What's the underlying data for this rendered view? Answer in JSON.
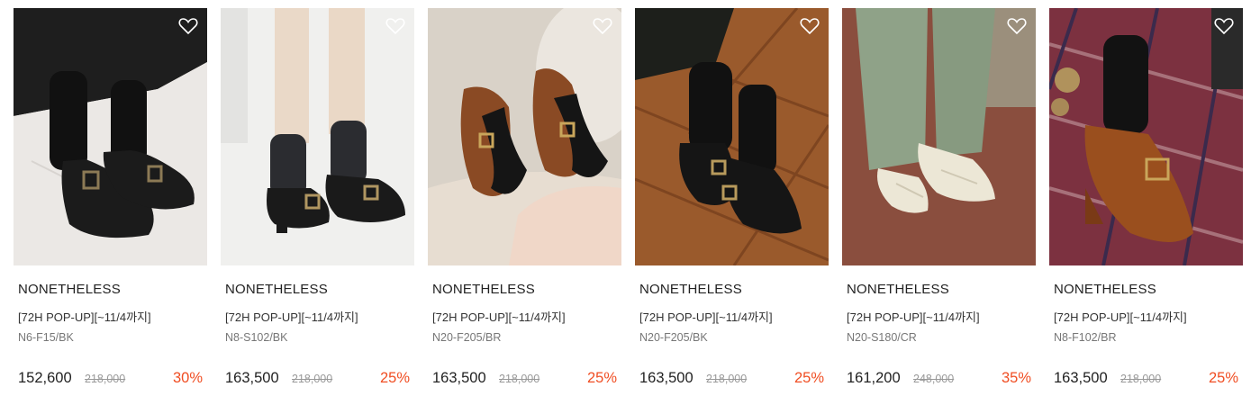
{
  "products": [
    {
      "brand": "NONETHELESS",
      "title": "[72H POP-UP][~11/4까지]",
      "code": "N6-F15/BK",
      "price": "152,600",
      "original_price": "218,000",
      "discount": "30%",
      "shoe_color": "#1b1b1b",
      "bg_color": "#e9e6e3"
    },
    {
      "brand": "NONETHELESS",
      "title": "[72H POP-UP][~11/4까지]",
      "code": "N8-S102/BK",
      "price": "163,500",
      "original_price": "218,000",
      "discount": "25%",
      "shoe_color": "#1a1a1a",
      "bg_color": "#eeeeec"
    },
    {
      "brand": "NONETHELESS",
      "title": "[72H POP-UP][~11/4까지]",
      "code": "N20-F205/BR",
      "price": "163,500",
      "original_price": "218,000",
      "discount": "25%",
      "shoe_color": "#8a4a24",
      "bg_color": "#ddd6cd"
    },
    {
      "brand": "NONETHELESS",
      "title": "[72H POP-UP][~11/4까지]",
      "code": "N20-F205/BK",
      "price": "163,500",
      "original_price": "218,000",
      "discount": "25%",
      "shoe_color": "#151515",
      "bg_color": "#9a5a2c"
    },
    {
      "brand": "NONETHELESS",
      "title": "[72H POP-UP][~11/4까지]",
      "code": "N20-S180/CR",
      "price": "161,200",
      "original_price": "248,000",
      "discount": "35%",
      "shoe_color": "#ece7d6",
      "bg_color": "#8a4e3e"
    },
    {
      "brand": "NONETHELESS",
      "title": "[72H POP-UP][~11/4까지]",
      "code": "N8-F102/BR",
      "price": "163,500",
      "original_price": "218,000",
      "discount": "25%",
      "shoe_color": "#9a4f1e",
      "bg_color": "#7c3140"
    }
  ],
  "icons": {
    "wishlist": "heart-outline-icon"
  },
  "colors": {
    "discount": "#f04e23",
    "original_price": "#999999"
  }
}
